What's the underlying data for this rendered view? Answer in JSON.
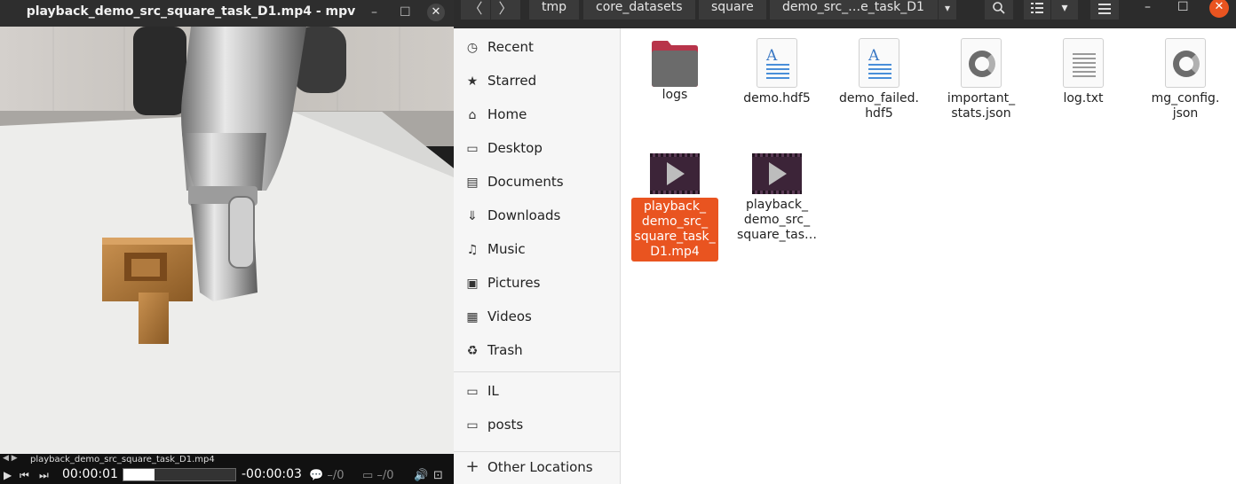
{
  "mpv": {
    "title": "playback_demo_src_square_task_D1.mp4 - mpv",
    "controls": {
      "minimize": "–",
      "maximize": "☐",
      "close": "✕"
    },
    "osc": {
      "filename": "playback_demo_src_square_task_D1.mp4",
      "nav": "◀ ▶",
      "play_icon": "▶",
      "prev_icon": "⏮",
      "next_icon": "⏭",
      "elapsed": "00:00:01",
      "remaining": "-00:00:03",
      "progress_fraction": 0.28,
      "subtitle_track": "–/0",
      "audio_track": "–/0"
    }
  },
  "files": {
    "nav": {
      "back": "〈",
      "forward": "〉"
    },
    "breadcrumbs": [
      "tmp",
      "core_datasets",
      "square",
      "demo_src_…e_task_D1"
    ],
    "breadcrumb_dropdown": "▾",
    "toolbar": {
      "search_icon": "search-icon",
      "view_icon": "list-view-icon",
      "view_dropdown": "▾",
      "menu_icon": "hamburger-menu-icon"
    },
    "window_controls": {
      "minimize": "–",
      "maximize": "☐",
      "close": "✕"
    },
    "sidebar": {
      "items": [
        {
          "label": "Recent",
          "icon": "clock-icon",
          "glyph": "◷"
        },
        {
          "label": "Starred",
          "icon": "star-icon",
          "glyph": "★"
        },
        {
          "label": "Home",
          "icon": "home-icon",
          "glyph": "⌂"
        },
        {
          "label": "Desktop",
          "icon": "desktop-icon",
          "glyph": "▭"
        },
        {
          "label": "Documents",
          "icon": "document-icon",
          "glyph": "▤"
        },
        {
          "label": "Downloads",
          "icon": "download-icon",
          "glyph": "⇓"
        },
        {
          "label": "Music",
          "icon": "music-icon",
          "glyph": "♫"
        },
        {
          "label": "Pictures",
          "icon": "picture-icon",
          "glyph": "▣"
        },
        {
          "label": "Videos",
          "icon": "video-icon",
          "glyph": "▦"
        },
        {
          "label": "Trash",
          "icon": "trash-icon",
          "glyph": "♻"
        }
      ],
      "bookmarks": [
        {
          "label": "IL",
          "icon": "folder-icon",
          "glyph": "▭"
        },
        {
          "label": "posts",
          "icon": "folder-icon",
          "glyph": "▭"
        }
      ],
      "other": {
        "label": "Other Locations",
        "icon": "plus-icon",
        "glyph": "+"
      }
    },
    "items": [
      {
        "name": "logs",
        "type": "folder"
      },
      {
        "name": "demo.hdf5",
        "type": "doc"
      },
      {
        "name": "demo_failed.\nhdf5",
        "type": "doc"
      },
      {
        "name": "important_\nstats.json",
        "type": "json"
      },
      {
        "name": "log.txt",
        "type": "txt"
      },
      {
        "name": "mg_config.\njson",
        "type": "json"
      },
      {
        "name": "playback_\ndemo_src_\nsquare_task_\nD1.mp4",
        "type": "video",
        "selected": true
      },
      {
        "name": "playback_\ndemo_src_\nsquare_tas…",
        "type": "video"
      }
    ],
    "accent_color": "#e95420"
  }
}
